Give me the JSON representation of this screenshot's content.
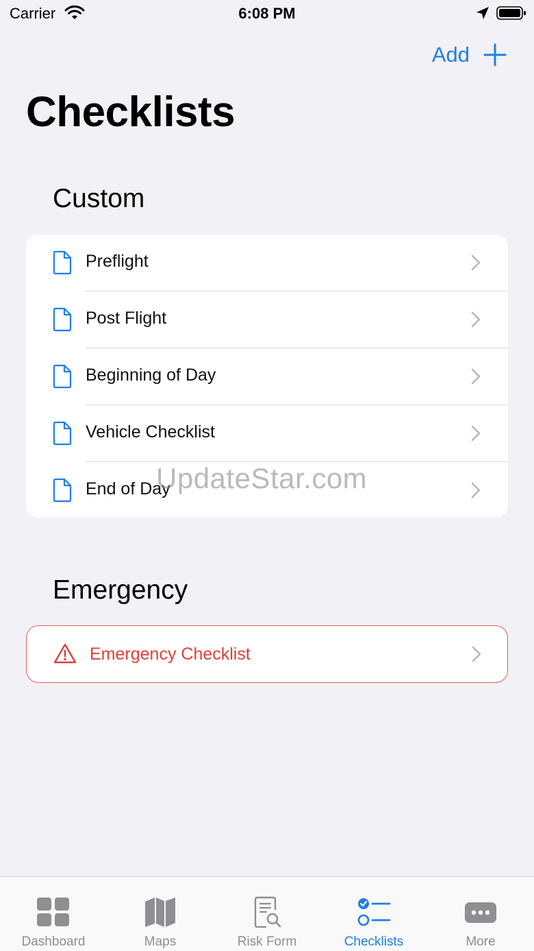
{
  "status_bar": {
    "carrier": "Carrier",
    "time": "6:08 PM"
  },
  "nav": {
    "add_label": "Add"
  },
  "page_title": "Checklists",
  "sections": {
    "custom": {
      "title": "Custom",
      "items": [
        {
          "label": "Preflight"
        },
        {
          "label": "Post Flight"
        },
        {
          "label": "Beginning of Day"
        },
        {
          "label": "Vehicle Checklist"
        },
        {
          "label": "End of Day"
        }
      ]
    },
    "emergency": {
      "title": "Emergency",
      "items": [
        {
          "label": "Emergency Checklist"
        }
      ]
    }
  },
  "watermark": "UpdateStar.com",
  "tab_bar": {
    "active": "Checklists",
    "tabs": [
      {
        "label": "Dashboard",
        "icon": "grid-icon"
      },
      {
        "label": "Maps",
        "icon": "map-icon"
      },
      {
        "label": "Risk Form",
        "icon": "doc-search-icon"
      },
      {
        "label": "Checklists",
        "icon": "checklist-icon"
      },
      {
        "label": "More",
        "icon": "more-icon"
      }
    ]
  },
  "colors": {
    "accent": "#1f7ee8",
    "danger": "#e0403c",
    "background": "#f2f1f6",
    "inactive": "#8e8e93"
  }
}
